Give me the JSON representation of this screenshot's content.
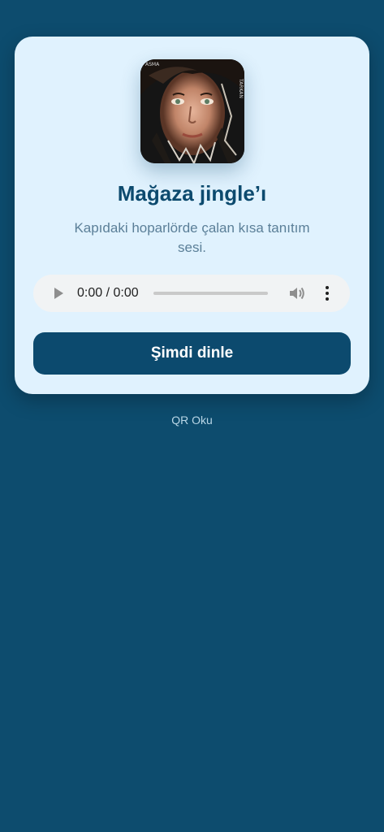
{
  "card": {
    "cover_alt": "album-cover",
    "title": "Mağaza jingle’ı",
    "description": "Kapıdaki hoparlörde çalan kısa tanıtım sesi."
  },
  "audio_player": {
    "time_display": "0:00 / 0:00",
    "progress": 0,
    "icons": [
      "play-icon",
      "volume-icon",
      "more-options-icon"
    ]
  },
  "primary_button": {
    "label": "Şimdi dinle"
  },
  "footer_link": {
    "label": "QR Oku"
  },
  "colors": {
    "background": "#0d4c6e",
    "card": "#e0f2fe",
    "accent": "#0c4a6e",
    "muted_text": "#5b7f98",
    "player_bg": "#f1f3f4"
  }
}
